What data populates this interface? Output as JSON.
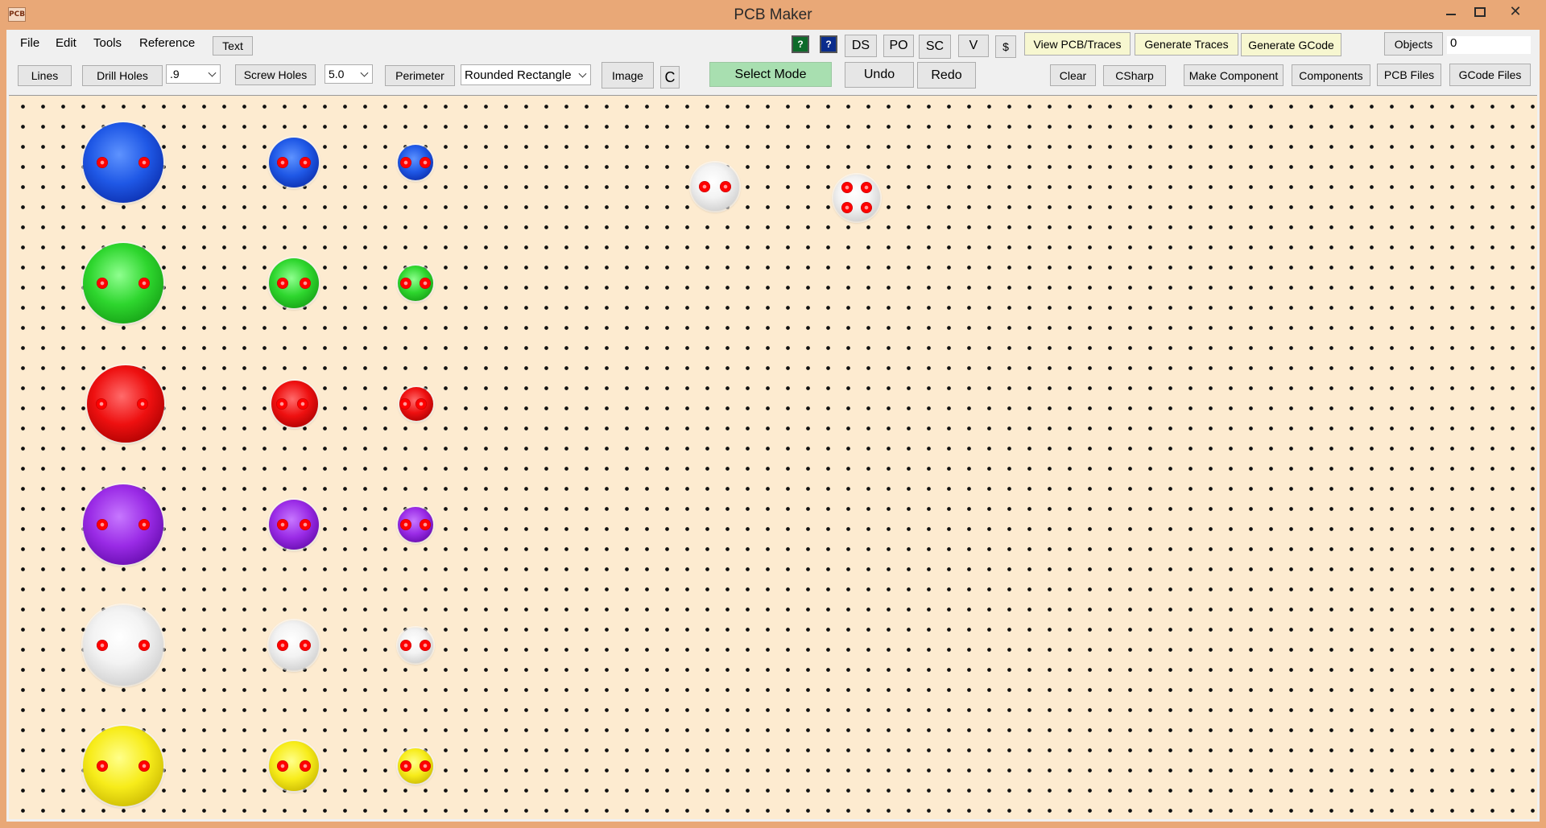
{
  "window": {
    "title": "PCB Maker",
    "icon_text": "PCB",
    "minimize_icon": "minimize-icon",
    "maximize_icon": "maximize-icon",
    "close_icon": "close-icon",
    "close_glyph": "✕"
  },
  "menu": {
    "file": "File",
    "edit": "Edit",
    "tools": "Tools",
    "reference": "Reference"
  },
  "toolbar_top": {
    "text_button": "Text",
    "help_green": "?",
    "help_blue": "?",
    "ds": "DS",
    "po": "PO",
    "sc": "SC",
    "v": "V",
    "dollar": "$",
    "view_pcb_traces": "View PCB/Traces",
    "generate_traces": "Generate Traces",
    "generate_gcode": "Generate GCode",
    "objects": "Objects",
    "objects_count": "0"
  },
  "toolbar_bottom": {
    "lines": "Lines",
    "drill_holes": "Drill Holes",
    "drill_size": ".9",
    "screw_holes": "Screw Holes",
    "screw_size": "5.0",
    "perimeter": "Perimeter",
    "perimeter_shape": "Rounded Rectangle",
    "image": "Image",
    "c": "C",
    "select_mode": "Select Mode",
    "undo": "Undo",
    "redo": "Redo",
    "clear": "Clear",
    "csharp": "CSharp",
    "make_component": "Make Component",
    "components": "Components",
    "pcb_files": "PCB Files",
    "gcode_files": "GCode Files"
  },
  "colors": {
    "board_background": "#fdebd0",
    "window_frame": "#e9a877",
    "pad": "#ff0000",
    "select_mode": "#a8dfb0"
  },
  "components": [
    {
      "color": "blue"
    },
    {
      "color": "blue"
    },
    {
      "color": "blue"
    },
    {
      "color": "green"
    },
    {
      "color": "green"
    },
    {
      "color": "green"
    },
    {
      "color": "red"
    },
    {
      "color": "red"
    },
    {
      "color": "red"
    },
    {
      "color": "purple"
    },
    {
      "color": "purple"
    },
    {
      "color": "purple"
    },
    {
      "color": "white"
    },
    {
      "color": "white"
    },
    {
      "color": "white"
    },
    {
      "color": "yellow"
    },
    {
      "color": "yellow"
    },
    {
      "color": "yellow"
    },
    {
      "color": "white"
    },
    {
      "color": "white"
    }
  ]
}
